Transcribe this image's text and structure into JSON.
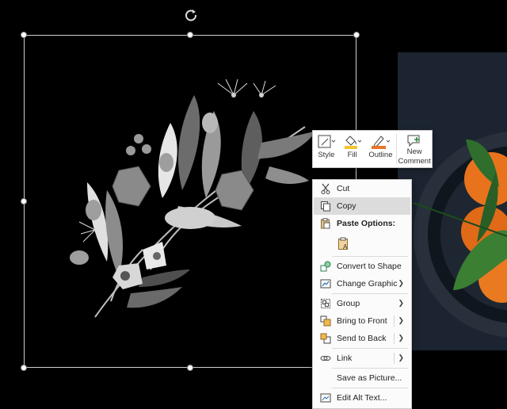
{
  "mini_toolbar": {
    "style_label": "Style",
    "fill_label": "Fill",
    "outline_label": "Outline",
    "new_comment_line1": "New",
    "new_comment_line2": "Comment",
    "fill_color": "#f4c430",
    "outline_color": "#e8762c"
  },
  "context_menu": {
    "cut": "Cut",
    "copy": "Copy",
    "paste_options": "Paste Options:",
    "convert_to_shape": "Convert to Shape",
    "change_graphic": "Change Graphic",
    "group": "Group",
    "bring_to_front": "Bring to Front",
    "send_to_back": "Send to Back",
    "link": "Link",
    "save_as_picture": "Save as Picture...",
    "edit_alt_text": "Edit Alt Text..."
  },
  "icons": [
    "rotate-icon",
    "style-icon",
    "fill-bucket-icon",
    "outline-pen-icon",
    "new-comment-icon",
    "scissors-icon",
    "copy-icon",
    "paste-icon",
    "convert-shape-icon",
    "change-graphic-icon",
    "group-icon",
    "bring-front-icon",
    "send-back-icon",
    "link-icon",
    "alt-text-icon"
  ]
}
